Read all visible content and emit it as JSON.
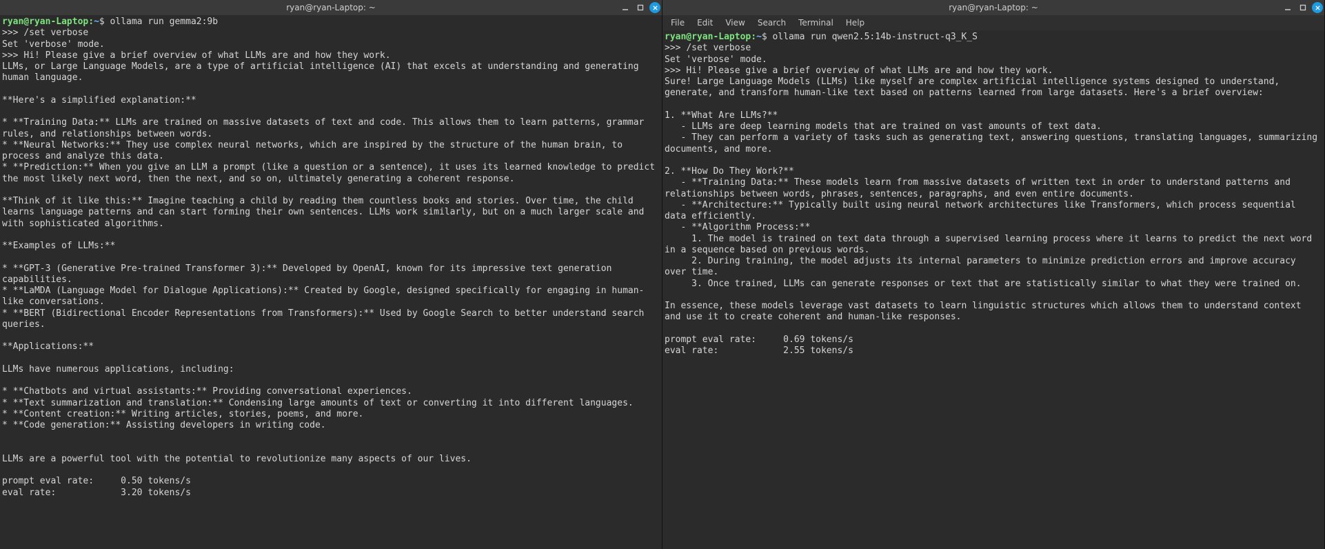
{
  "left": {
    "title": "ryan@ryan-Laptop: ~",
    "prompt": {
      "user_host": "ryan@ryan-Laptop:",
      "path": "~",
      "dollar": "$"
    },
    "command": "ollama run gemma2:9b",
    "repl_marker": ">>>",
    "lines": {
      "l0": "/set verbose",
      "l1": "Set 'verbose' mode.",
      "l2": "Hi! Please give a brief overview of what LLMs are and how they work.",
      "l3": "LLMs, or Large Language Models, are a type of artificial intelligence (AI) that excels at understanding and generating human language.",
      "l4": "",
      "l5": "**Here's a simplified explanation:**",
      "l6": "",
      "l7": "* **Training Data:** LLMs are trained on massive datasets of text and code. This allows them to learn patterns, grammar rules, and relationships between words.",
      "l8": "* **Neural Networks:** They use complex neural networks, which are inspired by the structure of the human brain, to process and analyze this data.",
      "l9": "* **Prediction:** When you give an LLM a prompt (like a question or a sentence), it uses its learned knowledge to predict the most likely next word, then the next, and so on, ultimately generating a coherent response.",
      "l10": "",
      "l11": "**Think of it like this:** Imagine teaching a child by reading them countless books and stories. Over time, the child learns language patterns and can start forming their own sentences. LLMs work similarly, but on a much larger scale and with sophisticated algorithms.",
      "l12": "",
      "l13": "**Examples of LLMs:**",
      "l14": "",
      "l15": "* **GPT-3 (Generative Pre-trained Transformer 3):** Developed by OpenAI, known for its impressive text generation capabilities.",
      "l16": "* **LaMDA (Language Model for Dialogue Applications):** Created by Google, designed specifically for engaging in human-like conversations.",
      "l17": "* **BERT (Bidirectional Encoder Representations from Transformers):** Used by Google Search to better understand search queries.",
      "l18": "",
      "l19": "**Applications:**",
      "l20": "",
      "l21": "LLMs have numerous applications, including:",
      "l22": "",
      "l23": "* **Chatbots and virtual assistants:** Providing conversational experiences.",
      "l24": "* **Text summarization and translation:** Condensing large amounts of text or converting it into different languages.",
      "l25": "* **Content creation:** Writing articles, stories, poems, and more.",
      "l26": "* **Code generation:** Assisting developers in writing code.",
      "l27": "",
      "l28": "",
      "l29": "LLMs are a powerful tool with the potential to revolutionize many aspects of our lives.",
      "l30": "",
      "l31": "prompt eval rate:     0.50 tokens/s",
      "l32": "eval rate:            3.20 tokens/s"
    },
    "stats": {
      "prompt_eval_rate": "0.50 tokens/s",
      "eval_rate": "3.20 tokens/s"
    }
  },
  "right": {
    "title": "ryan@ryan-Laptop: ~",
    "menubar": [
      "File",
      "Edit",
      "View",
      "Search",
      "Terminal",
      "Help"
    ],
    "prompt": {
      "user_host": "ryan@ryan-Laptop:",
      "path": "~",
      "dollar": "$"
    },
    "command": "ollama run qwen2.5:14b-instruct-q3_K_S",
    "repl_marker": ">>>",
    "lines": {
      "l0": "/set verbose",
      "l1": "Set 'verbose' mode.",
      "l2": "Hi! Please give a brief overview of what LLMs are and how they work.",
      "l3": "Sure! Large Language Models (LLMs) like myself are complex artificial intelligence systems designed to understand, generate, and transform human-like text based on patterns learned from large datasets. Here's a brief overview:",
      "l4": "",
      "l5": "1. **What Are LLMs?**",
      "l6": "   - LLMs are deep learning models that are trained on vast amounts of text data.",
      "l7": "   - They can perform a variety of tasks such as generating text, answering questions, translating languages, summarizing documents, and more.",
      "l8": "",
      "l9": "2. **How Do They Work?**",
      "l10": "   - **Training Data:** These models learn from massive datasets of written text in order to understand patterns and relationships between words, phrases, sentences, paragraphs, and even entire documents.",
      "l11": "   - **Architecture:** Typically built using neural network architectures like Transformers, which process sequential data efficiently.",
      "l12": "   - **Algorithm Process:**",
      "l13": "     1. The model is trained on text data through a supervised learning process where it learns to predict the next word in a sequence based on previous words.",
      "l14": "     2. During training, the model adjusts its internal parameters to minimize prediction errors and improve accuracy over time.",
      "l15": "     3. Once trained, LLMs can generate responses or text that are statistically similar to what they were trained on.",
      "l16": "",
      "l17": "In essence, these models leverage vast datasets to learn linguistic structures which allows them to understand context and use it to create coherent and human-like responses.",
      "l18": "",
      "l19": "prompt eval rate:     0.69 tokens/s",
      "l20": "eval rate:            2.55 tokens/s"
    },
    "stats": {
      "prompt_eval_rate": "0.69 tokens/s",
      "eval_rate": "2.55 tokens/s"
    }
  }
}
